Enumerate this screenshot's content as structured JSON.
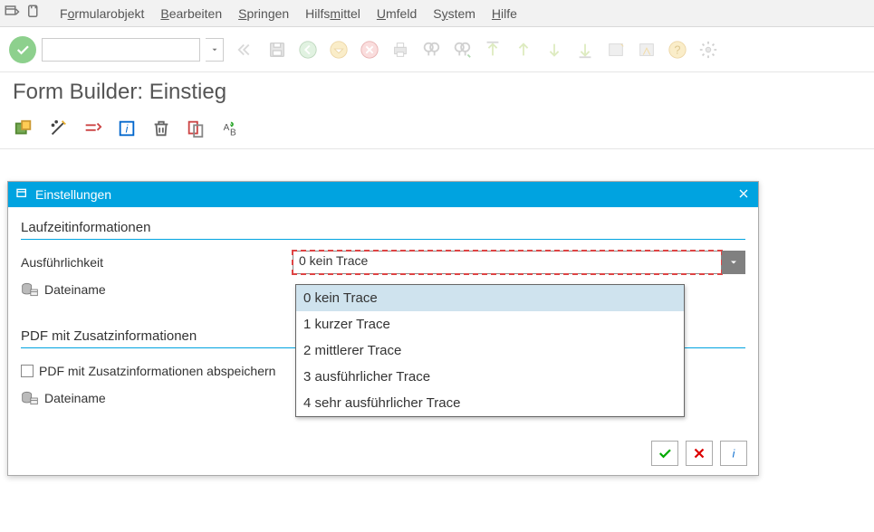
{
  "menubar": {
    "items": [
      {
        "pre": "F",
        "u": "o",
        "post": "rmularobjekt"
      },
      {
        "pre": "",
        "u": "B",
        "post": "earbeiten"
      },
      {
        "pre": "",
        "u": "S",
        "post": "pringen"
      },
      {
        "pre": "Hilfs",
        "u": "m",
        "post": "ittel"
      },
      {
        "pre": "",
        "u": "U",
        "post": "mfeld"
      },
      {
        "pre": "S",
        "u": "y",
        "post": "stem"
      },
      {
        "pre": "",
        "u": "H",
        "post": "ilfe"
      }
    ]
  },
  "page": {
    "title": "Form Builder: Einstieg"
  },
  "dialog": {
    "title": "Einstellungen",
    "group1": {
      "title": "Laufzeitinformationen",
      "row1_label": "Ausführlichkeit",
      "row1_value": "0 kein Trace",
      "row2_label": "Dateiname"
    },
    "group2": {
      "title": "PDF mit Zusatzinformationen",
      "checkbox_label": "PDF mit Zusatzinformationen abspeichern",
      "row2_label": "Dateiname"
    }
  },
  "dropdown": {
    "options": [
      "0 kein Trace",
      "1 kurzer Trace",
      "2 mittlerer Trace",
      "3 ausführlicher Trace",
      "4 sehr ausführlicher Trace"
    ],
    "selected_index": 0
  }
}
